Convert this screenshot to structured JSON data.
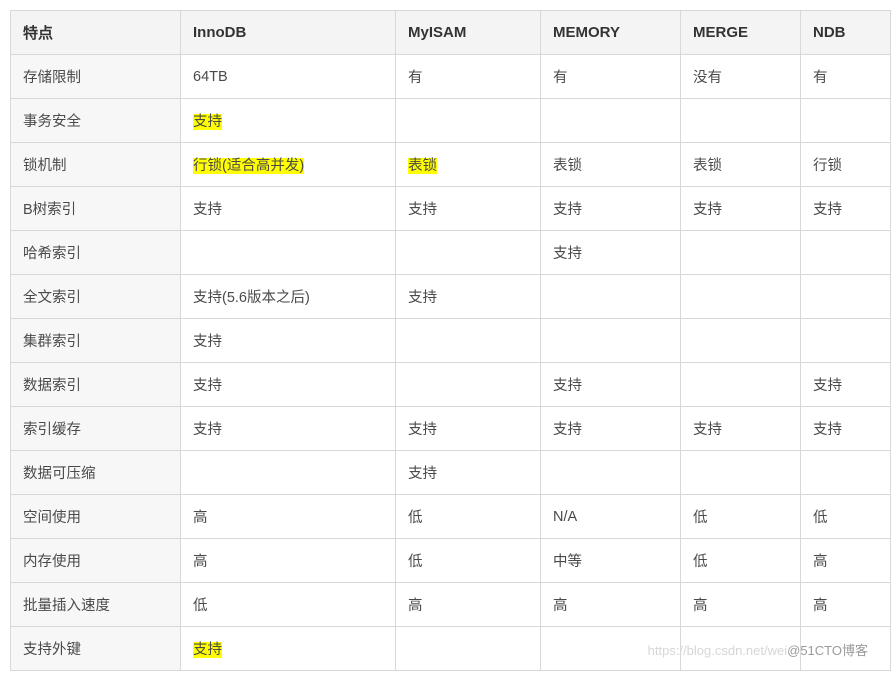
{
  "headers": [
    "特点",
    "InnoDB",
    "MyISAM",
    "MEMORY",
    "MERGE",
    "NDB"
  ],
  "rows": [
    {
      "label": "存储限制",
      "cells": [
        {
          "text": "64TB"
        },
        {
          "text": "有"
        },
        {
          "text": "有"
        },
        {
          "text": "没有"
        },
        {
          "text": "有"
        }
      ]
    },
    {
      "label": "事务安全",
      "cells": [
        {
          "text": "支持",
          "highlight": true
        },
        {
          "text": ""
        },
        {
          "text": ""
        },
        {
          "text": ""
        },
        {
          "text": ""
        }
      ]
    },
    {
      "label": "锁机制",
      "cells": [
        {
          "text": "行锁(适合高并发)",
          "highlight": true
        },
        {
          "text": "表锁",
          "highlight": true
        },
        {
          "text": "表锁"
        },
        {
          "text": "表锁"
        },
        {
          "text": "行锁"
        }
      ]
    },
    {
      "label": "B树索引",
      "cells": [
        {
          "text": "支持"
        },
        {
          "text": "支持"
        },
        {
          "text": "支持"
        },
        {
          "text": "支持"
        },
        {
          "text": "支持"
        }
      ]
    },
    {
      "label": "哈希索引",
      "cells": [
        {
          "text": ""
        },
        {
          "text": ""
        },
        {
          "text": "支持"
        },
        {
          "text": ""
        },
        {
          "text": ""
        }
      ]
    },
    {
      "label": "全文索引",
      "cells": [
        {
          "text": "支持(5.6版本之后)"
        },
        {
          "text": "支持"
        },
        {
          "text": ""
        },
        {
          "text": ""
        },
        {
          "text": ""
        }
      ]
    },
    {
      "label": "集群索引",
      "cells": [
        {
          "text": "支持"
        },
        {
          "text": ""
        },
        {
          "text": ""
        },
        {
          "text": ""
        },
        {
          "text": ""
        }
      ]
    },
    {
      "label": "数据索引",
      "cells": [
        {
          "text": "支持"
        },
        {
          "text": ""
        },
        {
          "text": "支持"
        },
        {
          "text": ""
        },
        {
          "text": "支持"
        }
      ]
    },
    {
      "label": "索引缓存",
      "cells": [
        {
          "text": "支持"
        },
        {
          "text": "支持"
        },
        {
          "text": "支持"
        },
        {
          "text": "支持"
        },
        {
          "text": "支持"
        }
      ]
    },
    {
      "label": "数据可压缩",
      "cells": [
        {
          "text": ""
        },
        {
          "text": "支持"
        },
        {
          "text": ""
        },
        {
          "text": ""
        },
        {
          "text": ""
        }
      ]
    },
    {
      "label": "空间使用",
      "cells": [
        {
          "text": "高"
        },
        {
          "text": "低"
        },
        {
          "text": "N/A"
        },
        {
          "text": "低"
        },
        {
          "text": "低"
        }
      ]
    },
    {
      "label": "内存使用",
      "cells": [
        {
          "text": "高"
        },
        {
          "text": "低"
        },
        {
          "text": "中等"
        },
        {
          "text": "低"
        },
        {
          "text": "高"
        }
      ]
    },
    {
      "label": "批量插入速度",
      "cells": [
        {
          "text": "低"
        },
        {
          "text": "高"
        },
        {
          "text": "高"
        },
        {
          "text": "高"
        },
        {
          "text": "高"
        }
      ]
    },
    {
      "label": "支持外键",
      "cells": [
        {
          "text": "支持",
          "highlight": true
        },
        {
          "text": ""
        },
        {
          "text": ""
        },
        {
          "text": ""
        },
        {
          "text": ""
        }
      ]
    }
  ],
  "watermark": {
    "faint": "https://blog.csdn.net/wei",
    "main": "@51CTO博客"
  }
}
